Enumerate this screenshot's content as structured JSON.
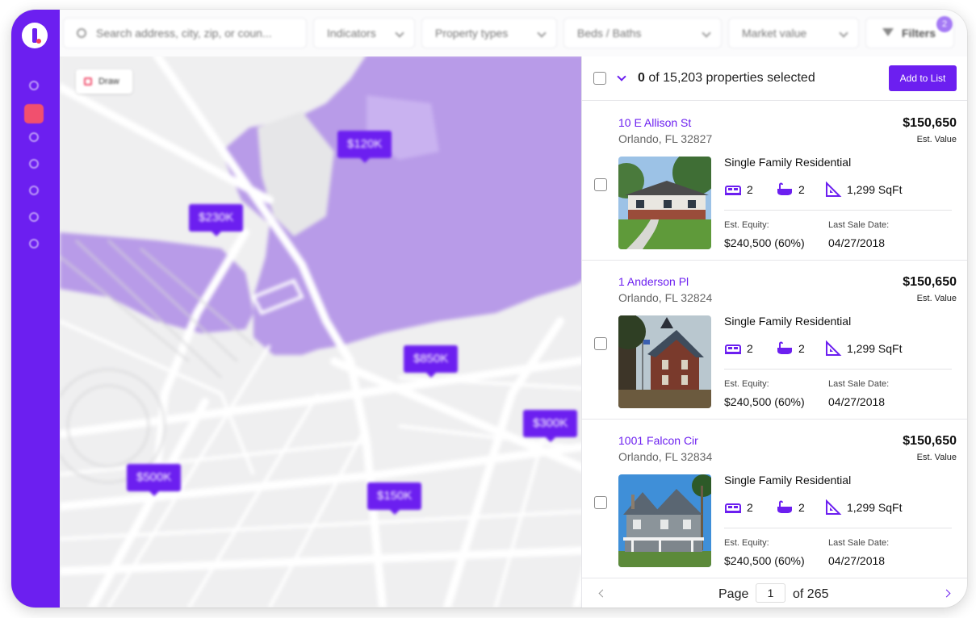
{
  "topbar": {
    "search_placeholder": "Search address, city, zip, or coun...",
    "indicators": "Indicators",
    "property_types": "Property types",
    "beds_baths": "Beds / Baths",
    "market_value": "Market value",
    "filters": "Filters",
    "filters_badge": "2"
  },
  "map": {
    "draw_label": "Draw",
    "pins": [
      "$120K",
      "$230K",
      "$850K",
      "$300K",
      "$500K",
      "$150K"
    ]
  },
  "panel": {
    "selected_count": "0",
    "selected_suffix": "of 15,203 properties selected",
    "add_to_list": "Add to List",
    "properties": [
      {
        "address": "10 E Allison St",
        "city": "Orlando, FL 32827",
        "price": "$150,650",
        "price_label": "Est. Value",
        "type": "Single Family Residential",
        "beds": "2",
        "baths": "2",
        "sqft": "1,299 SqFt",
        "equity_label": "Est. Equity:",
        "equity": "$240,500 (60%)",
        "sale_label": "Last Sale Date:",
        "sale_date": "04/27/2018"
      },
      {
        "address": "1 Anderson Pl",
        "city": "Orlando, FL 32824",
        "price": "$150,650",
        "price_label": "Est. Value",
        "type": "Single Family Residential",
        "beds": "2",
        "baths": "2",
        "sqft": "1,299 SqFt",
        "equity_label": "Est. Equity:",
        "equity": "$240,500 (60%)",
        "sale_label": "Last Sale Date:",
        "sale_date": "04/27/2018"
      },
      {
        "address": "1001 Falcon Cir",
        "city": "Orlando, FL 32834",
        "price": "$150,650",
        "price_label": "Est. Value",
        "type": "Single Family Residential",
        "beds": "2",
        "baths": "2",
        "sqft": "1,299 SqFt",
        "equity_label": "Est. Equity:",
        "equity": "$240,500 (60%)",
        "sale_label": "Last Sale Date:",
        "sale_date": "04/27/2018"
      }
    ],
    "pager": {
      "page_label": "Page",
      "current": "1",
      "of_label": "of 265"
    }
  },
  "colors": {
    "brand": "#6c1ff0",
    "accent": "#f1506e",
    "region": "#b89be8"
  }
}
